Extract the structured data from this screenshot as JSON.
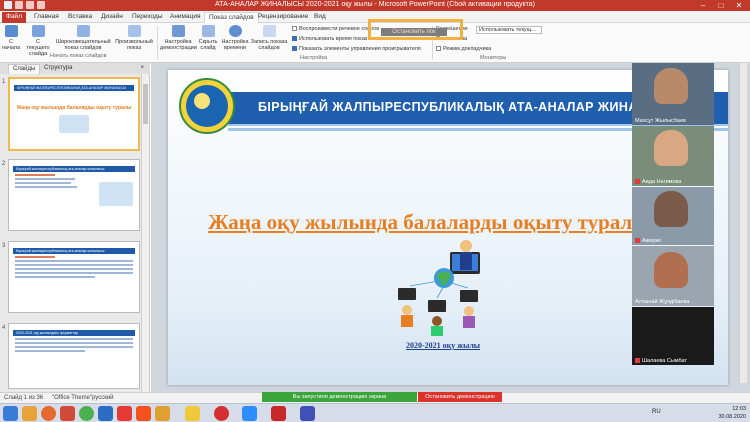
{
  "window": {
    "title": "АТА-АНАЛАР ЖИНАЛЫСЫ 2020-2021 оқу жылы  -  Microsoft PowerPoint (Сбой активации продукта)"
  },
  "ribbon_tabs": [
    "Файл",
    "Главная",
    "Вставка",
    "Дизайн",
    "Переходы",
    "Анимация",
    "Показ слайдов",
    "Рецензирование",
    "Вид"
  ],
  "ribbon": {
    "buttons": [
      {
        "label": "С начала"
      },
      {
        "label": "С текущего слайда"
      },
      {
        "label": "Широковещательный показ слайдов"
      },
      {
        "label": "Произвольный показ"
      },
      {
        "label": "Настройка демонстрации"
      },
      {
        "label": "Скрыть слайд"
      },
      {
        "label": "Настройка времени"
      },
      {
        "label": "Запись показа слайдов"
      }
    ],
    "checkboxes": [
      {
        "label": "Воспроизвести речевое сопров",
        "checked": false
      },
      {
        "label": "Использовать время показ",
        "checked": true
      },
      {
        "label": "Показать элементы управления проигрывателя",
        "checked": true
      }
    ],
    "monitor": {
      "resolution_label": "Разрешение",
      "resolution_value": "Использовать текущ...",
      "show_on_label": "Показать на",
      "presenter_label": "Режим докладчика"
    },
    "groups": [
      "Начать показ слайдов",
      "Настройка",
      "Мониторы"
    ],
    "share_overlay_text": "Остановить пок"
  },
  "panel": {
    "tabs": [
      "Слайды",
      "Структура"
    ],
    "close_label": "×",
    "thumbs": [
      {
        "num": "1",
        "bar": "БІРЫҢҒАЙ ЖАЛПЫРЕСПУБЛИКАЛЫҚ АТА-АНАЛАР ЖИНАЛЫСЫ",
        "title": "Жаңа оқу жылында балаларды оқыту туралы"
      },
      {
        "num": "2",
        "bar": "Бірыңғай жалпыреспубликалық ата-аналар жиналысы",
        "title": ""
      },
      {
        "num": "3",
        "bar": "Бірыңғай жалпыреспубликалық ата-аналар жиналысы",
        "title": ""
      },
      {
        "num": "4",
        "bar": "2020-2021 оқу жылындағы форматтар",
        "title": ""
      }
    ]
  },
  "slide": {
    "banner": "БІРЫҢҒАЙ ЖАЛПЫРЕСПУБЛИКАЛЫҚ АТА-АНАЛАР ЖИНАЛЫСЫ",
    "heading": "Жаңа оқу жылында балаларды оқыту туралы",
    "year": "2020-2021 оқу жылы"
  },
  "participants": [
    {
      "name": "Махсұт Жылысбаев",
      "muted": false
    },
    {
      "name": "Аида Нагимова",
      "muted": true
    },
    {
      "name": "Ажерке",
      "muted": true
    },
    {
      "name": "Алтынай Жұндібаева",
      "muted": false
    },
    {
      "name": "Шалаева Сымбат",
      "muted": true
    }
  ],
  "status": {
    "slide_info": "Слайд 1 из 36",
    "theme": "\"Office Theme\"",
    "language": "русский",
    "share_banner": "Вы запустили демонстрацию экрана",
    "stop_banner": "Остановить демонстрацию"
  },
  "taskbar": {
    "lang": "RU",
    "time": "12:03",
    "date": "30.08.2020"
  },
  "colors": {
    "accent": "#c0392b",
    "banner": "#1f5fae",
    "heading": "#e67e22",
    "share_green": "#3aa53a",
    "stop_red": "#d9332b"
  }
}
